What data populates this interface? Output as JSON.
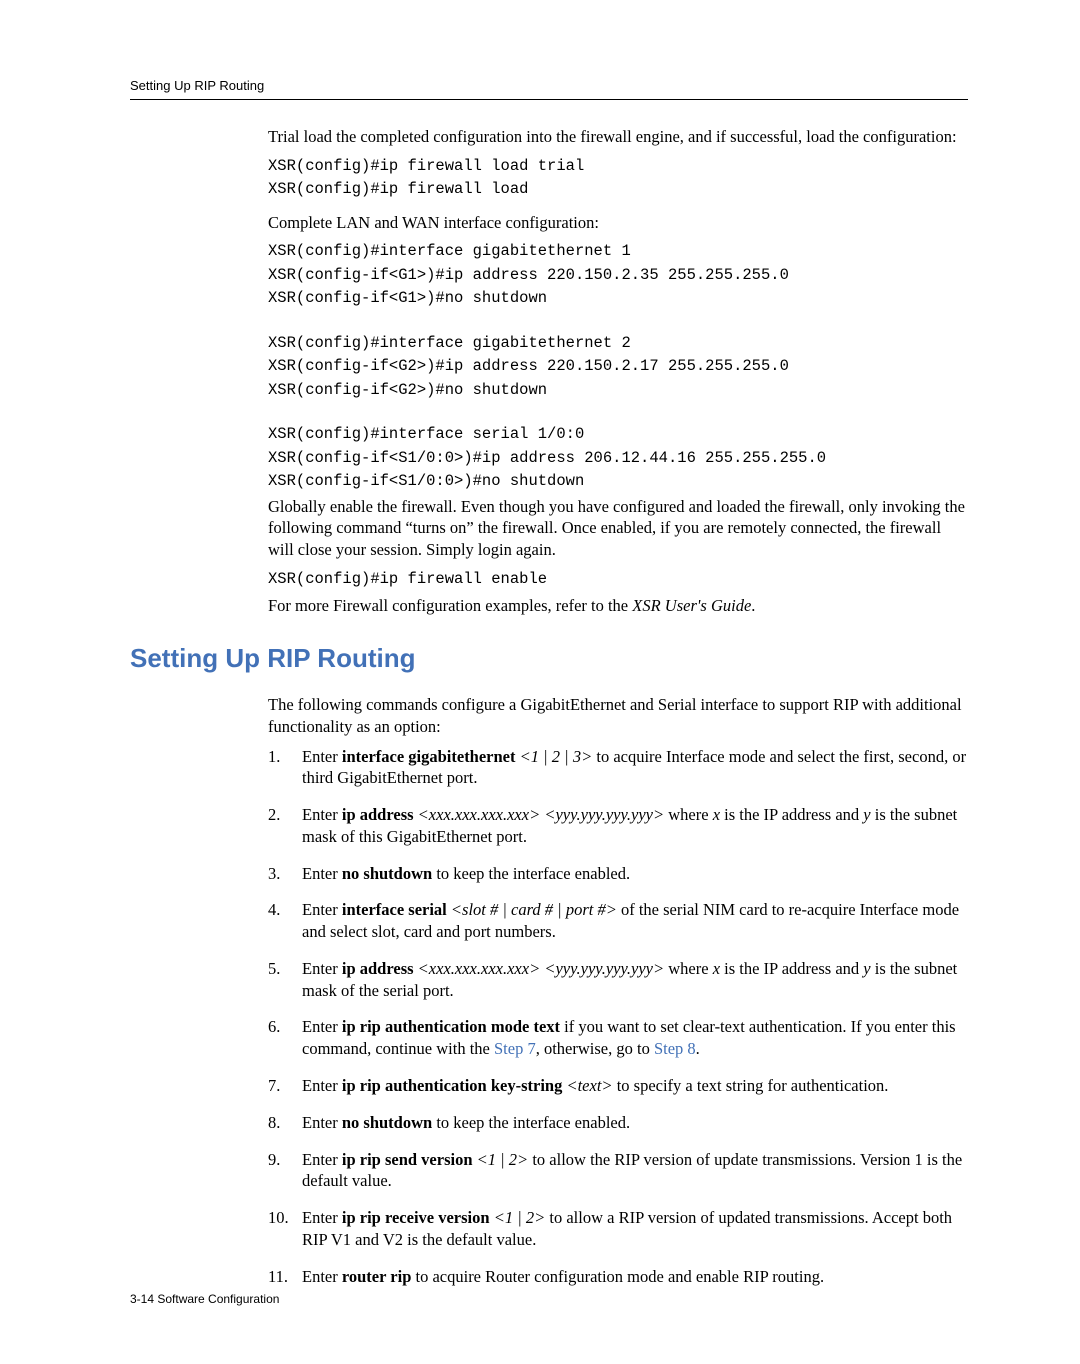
{
  "runningHead": "Setting Up RIP Routing",
  "intro1": "Trial load the completed configuration into the firewall engine, and if successful, load the configuration:",
  "code1a": "XSR(config)#ip firewall load trial",
  "code1b": "XSR(config)#ip firewall load",
  "intro2": "Complete LAN and WAN interface configuration:",
  "code2a": "XSR(config)#interface gigabitethernet 1",
  "code2b": "XSR(config-if<G1>)#ip address 220.150.2.35 255.255.255.0",
  "code2c": "XSR(config-if<G1>)#no shutdown",
  "code3a": "XSR(config)#interface gigabitethernet 2",
  "code3b": "XSR(config-if<G2>)#ip address 220.150.2.17 255.255.255.0",
  "code3c": "XSR(config-if<G2>)#no shutdown",
  "code4a": "XSR(config)#interface serial 1/0:0",
  "code4b": "XSR(config-if<S1/0:0>)#ip address 206.12.44.16 255.255.255.0",
  "code4c": "XSR(config-if<S1/0:0>)#no shutdown",
  "para4": "Globally enable the firewall. Even though you have configured and loaded the firewall, only invoking the following command “turns on” the firewall. Once enabled, if you are remotely connected, the firewall will close your session. Simply login again.",
  "code5": "XSR(config)#ip firewall enable",
  "para5a": "For more Firewall configuration examples, refer to the ",
  "para5b": "XSR User's Guide",
  "para5c": ".",
  "sectionTitle": "Setting Up RIP Routing",
  "sectionIntro": "The following commands configure a GigabitEthernet and Serial interface to support RIP with additional functionality as an option:",
  "steps": {
    "s1a": "Enter ",
    "s1b": "interface gigabitethernet ",
    "s1c": "<1 | 2 | 3>",
    "s1d": " to acquire Interface mode and select the first, second, or third GigabitEthernet port.",
    "s2a": "Enter ",
    "s2b": "ip address ",
    "s2c": "<xxx.xxx.xxx.xxx> <yyy.yyy.yyy.yyy>",
    "s2d": " where ",
    "s2e": "x",
    "s2f": " is the IP address and ",
    "s2g": "y",
    "s2h": " is the subnet mask of this GigabitEthernet port.",
    "s3a": "Enter ",
    "s3b": "no shutdown",
    "s3c": " to keep the interface enabled.",
    "s4a": "Enter ",
    "s4b": "interface serial ",
    "s4c": "<slot # | card # | port #>",
    "s4d": " of the serial NIM card to re-acquire Interface mode and select slot, card and port numbers.",
    "s5a": "Enter ",
    "s5b": "ip address ",
    "s5c": "<xxx.xxx.xxx.xxx> <yyy.yyy.yyy.yyy>",
    "s5d": " where ",
    "s5e": "x",
    "s5f": " is the IP address and ",
    "s5g": "y",
    "s5h": " is the subnet mask of the serial port.",
    "s6a": "Enter ",
    "s6b": "ip rip authentication mode text",
    "s6c": " if you want to set clear-text authentication. If you enter this command, continue with the ",
    "s6d": "Step 7",
    "s6e": ", otherwise, go to ",
    "s6f": "Step 8",
    "s6g": ".",
    "s7a": "Enter ",
    "s7b": "ip rip authentication key-string ",
    "s7c": "<text>",
    "s7d": " to specify a text string for authentication.",
    "s8a": "Enter ",
    "s8b": "no shutdown",
    "s8c": " to keep the interface enabled.",
    "s9a": "Enter ",
    "s9b": "ip rip send version ",
    "s9c": "<1 | 2>",
    "s9d": " to allow the RIP version of update transmissions. Version 1 is the default value.",
    "s10a": "Enter ",
    "s10b": "ip rip receive version ",
    "s10c": "<1 | 2>",
    "s10d": " to allow a RIP version of updated transmissions. Accept both RIP V1 and V2 is the default value.",
    "s11a": "Enter ",
    "s11b": "router rip",
    "s11c": " to acquire Router configuration mode and enable RIP routing."
  },
  "footer": "3-14   Software Configuration"
}
